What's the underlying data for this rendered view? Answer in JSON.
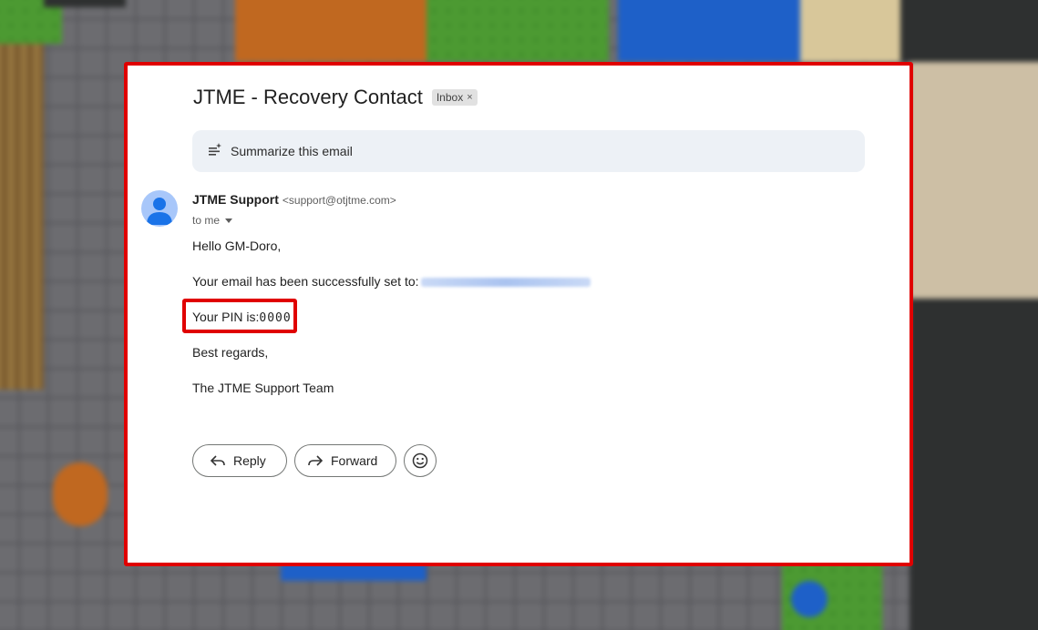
{
  "email": {
    "subject": "JTME - Recovery Contact",
    "label_chip": "Inbox",
    "label_chip_close": "×",
    "summarize_label": "Summarize this email",
    "sender_name": "JTME Support",
    "sender_email": "<support@otjtme.com>",
    "recipient": "to me",
    "greeting": "Hello GM-Doro,",
    "email_set_text": "Your email has been successfully set to:",
    "pin_label": "Your PIN is:",
    "pin_value": "0000",
    "closing": "Best regards,",
    "signature": "The JTME Support Team"
  },
  "actions": {
    "reply_label": "Reply",
    "forward_label": "Forward"
  },
  "icons": {
    "summarize": "sparkle-list-icon",
    "avatar": "person-icon",
    "reply": "reply-arrow-icon",
    "forward": "forward-arrow-icon",
    "emoji": "smiley-icon",
    "recipient_caret": "caret-down-icon"
  },
  "colors": {
    "highlight_border": "#e00000",
    "summarize_bg": "#edf1f6",
    "avatar_bg": "#a8c7fa",
    "avatar_fg": "#1a73e8"
  }
}
